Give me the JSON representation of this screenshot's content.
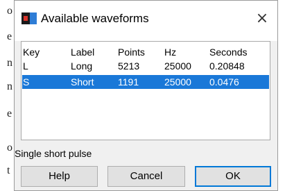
{
  "background_document": {
    "left_letters": [
      "o",
      "e",
      "n",
      "n",
      "e",
      "o",
      "t"
    ]
  },
  "dialog": {
    "title": "Available waveforms",
    "close_glyph": "×",
    "icons": [
      "app-icon",
      "close-icon"
    ]
  },
  "waveform_list": {
    "headers": [
      "Key",
      "Label",
      "Points",
      "Hz",
      "Seconds"
    ],
    "rows": [
      [
        "L",
        "Long",
        "5213",
        "25000",
        "0.20848"
      ],
      [
        "S",
        "Short",
        "1191",
        "25000",
        "0.0476"
      ]
    ],
    "selected_row": 1
  },
  "status": {
    "description": "Single short pulse"
  },
  "buttons": {
    "help": "Help",
    "cancel": "Cancel",
    "ok": "OK"
  },
  "colors": {
    "selection": "#1a78d8",
    "default_button_border": "#0078d7"
  }
}
